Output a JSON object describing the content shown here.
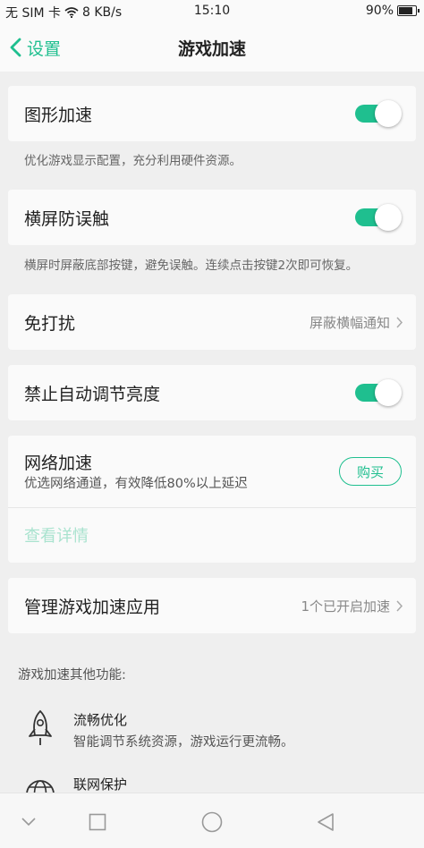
{
  "status_bar": {
    "carrier": "无 SIM 卡",
    "speed": "8 KB/s",
    "time": "15:10",
    "battery": "90%",
    "battery_level": 0.9
  },
  "header": {
    "back_label": "设置",
    "title": "游戏加速"
  },
  "settings": {
    "graphics_boost": {
      "label": "图形加速",
      "enabled": true,
      "desc": "优化游戏显示配置，充分利用硬件资源。"
    },
    "landscape_guard": {
      "label": "横屏防误触",
      "enabled": true,
      "desc": "横屏时屏蔽底部按键，避免误触。连续点击按键2次即可恢复。"
    },
    "no_disturb": {
      "label": "免打扰",
      "value": "屏蔽横幅通知"
    },
    "disable_auto_brightness": {
      "label": "禁止自动调节亮度",
      "enabled": true
    },
    "network_boost": {
      "label": "网络加速",
      "desc": "优选网络通道，有效降低80%以上延迟",
      "buy_label": "购买",
      "details_label": "查看详情"
    },
    "manage_apps": {
      "label": "管理游戏加速应用",
      "value": "1个已开启加速"
    }
  },
  "other_features": {
    "heading": "游戏加速其他功能:",
    "items": [
      {
        "icon": "rocket-icon",
        "title": "流畅优化",
        "desc": "智能调节系统资源，游戏运行更流畅。"
      },
      {
        "icon": "globe-icon",
        "title": "联网保护",
        "desc": ""
      }
    ]
  },
  "colors": {
    "accent": "#1fbf8f",
    "background": "#efefef",
    "card": "#fafafa"
  }
}
